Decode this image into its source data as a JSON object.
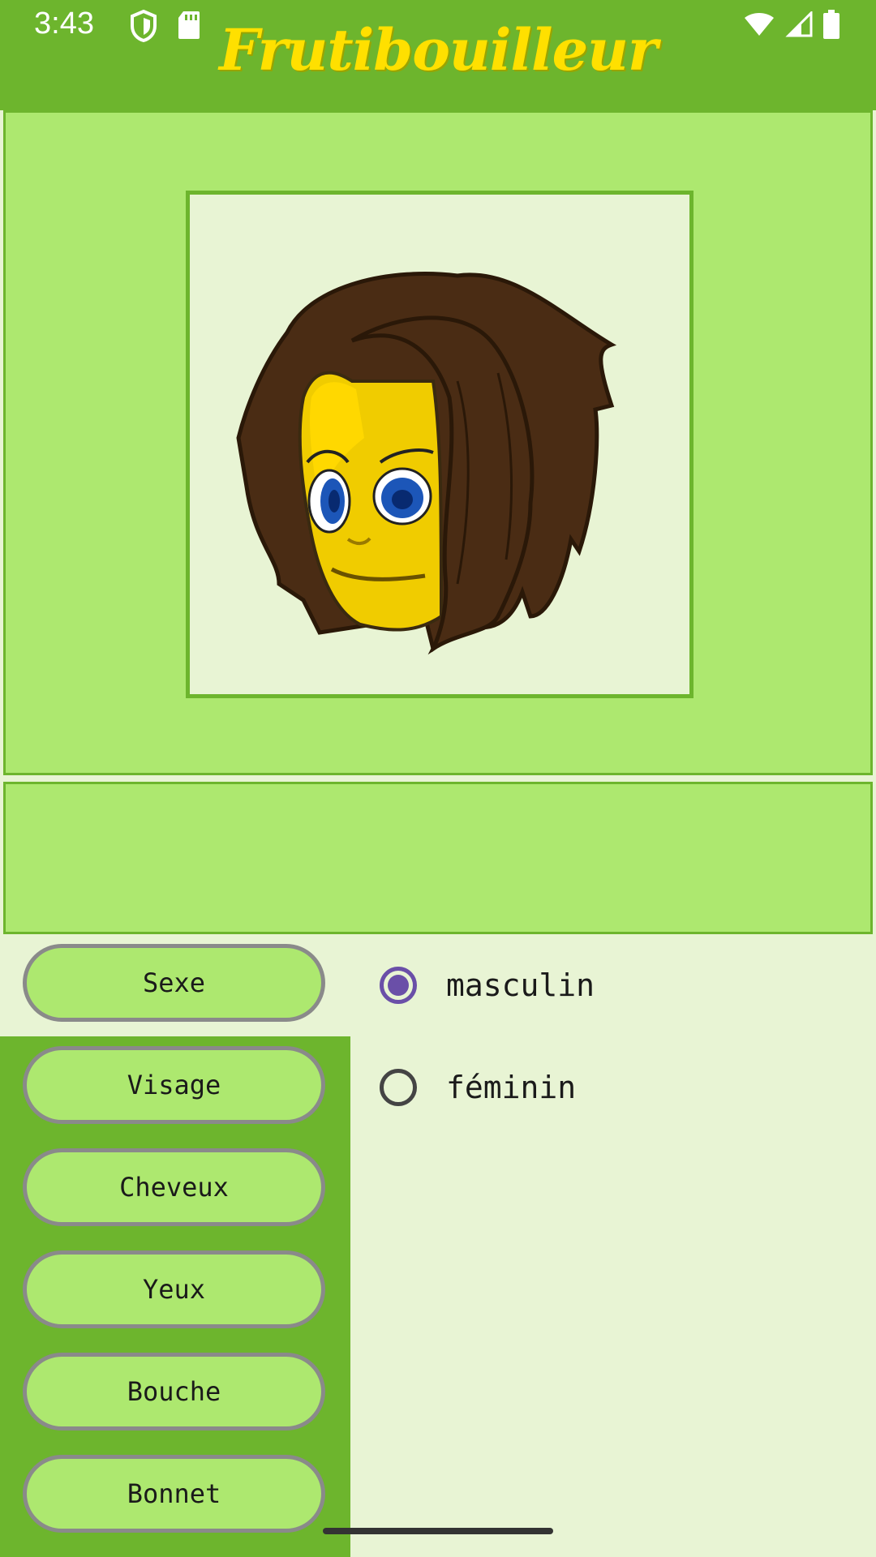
{
  "status_bar": {
    "time": "3:43"
  },
  "app": {
    "title": "Frutibouilleur"
  },
  "categories": [
    {
      "label": "Sexe"
    },
    {
      "label": "Visage"
    },
    {
      "label": "Cheveux"
    },
    {
      "label": "Yeux"
    },
    {
      "label": "Bouche"
    },
    {
      "label": "Bonnet"
    }
  ],
  "options": [
    {
      "label": "masculin",
      "selected": true
    },
    {
      "label": "féminin",
      "selected": false
    }
  ],
  "colors": {
    "header_green": "#6db52d",
    "panel_green": "#ade86f",
    "background": "#e8f4d4",
    "title_yellow": "#ffe000",
    "radio_accent": "#6a4fa8"
  }
}
